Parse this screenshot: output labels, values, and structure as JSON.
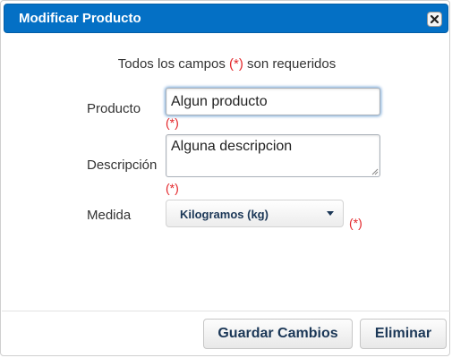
{
  "dialog": {
    "title": "Modificar Producto",
    "close_icon": "close-icon"
  },
  "form": {
    "required_note_prefix": "Todos los campos ",
    "required_mark": "(*)",
    "required_note_suffix": " son requeridos",
    "producto": {
      "label": "Producto",
      "value": "Algun producto"
    },
    "descripcion": {
      "label": "Descripción",
      "value": "Alguna descripcion"
    },
    "medida": {
      "label": "Medida",
      "selected": "Kilogramos (kg)",
      "dropdown_icon": "caret-down-icon"
    }
  },
  "actions": {
    "save_label": "Guardar Cambios",
    "delete_label": "Eliminar"
  },
  "colors": {
    "titlebar": "#0470c5",
    "required": "#e3262a",
    "button_text": "#1b3757"
  }
}
